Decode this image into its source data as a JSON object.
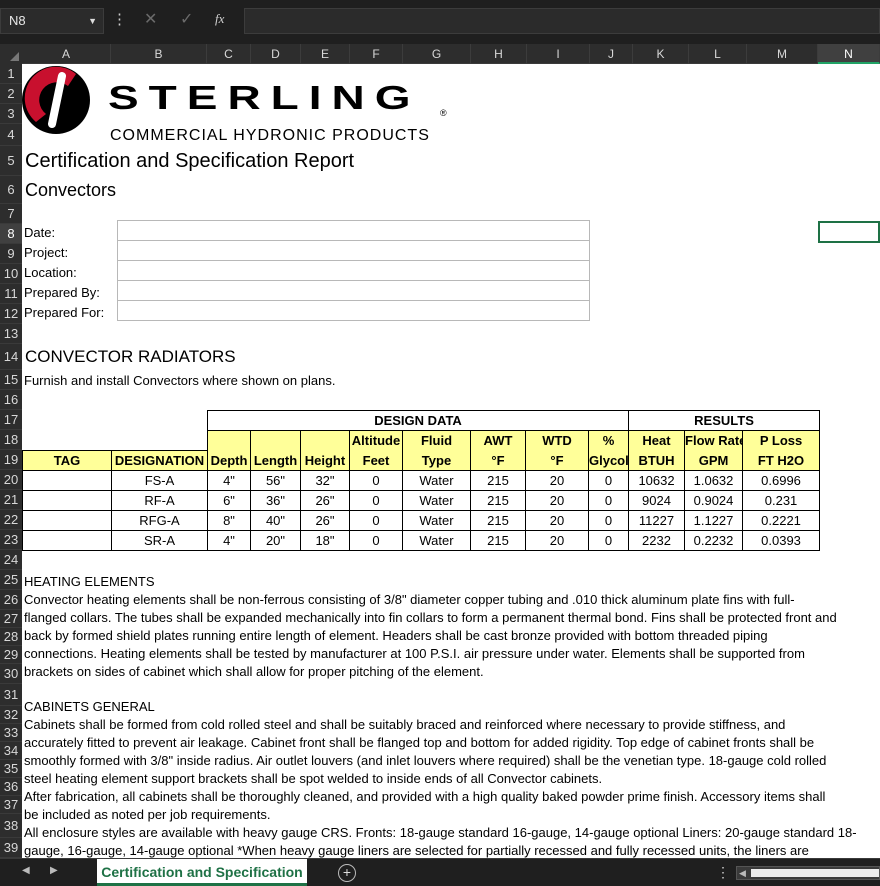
{
  "formula_bar": {
    "name_box": "N8",
    "more": "⋮",
    "cancel": "✕",
    "enter": "✓",
    "fx": "fx",
    "formula": ""
  },
  "columns": [
    "A",
    "B",
    "C",
    "D",
    "E",
    "F",
    "G",
    "H",
    "I",
    "J",
    "K",
    "L",
    "M",
    "N"
  ],
  "selected_column": "N",
  "rows": [
    "1",
    "2",
    "3",
    "4",
    "5",
    "6",
    "7",
    "8",
    "9",
    "10",
    "11",
    "12",
    "13",
    "14",
    "15",
    "16",
    "17",
    "18",
    "19",
    "20",
    "21",
    "22",
    "23",
    "24",
    "25",
    "26",
    "27",
    "28",
    "29",
    "30",
    "31",
    "32",
    "33",
    "34",
    "35",
    "36",
    "37",
    "38",
    "39"
  ],
  "selected_row": "8",
  "logo": {
    "name": "STERLING",
    "reg": "®",
    "tagline": "COMMERCIAL HYDRONIC PRODUCTS",
    "mark_color": "#c8102e"
  },
  "report": {
    "title": "Certification and Specification Report",
    "subtitle": "Convectors"
  },
  "info_fields": [
    "Date:",
    "Project:",
    "Location:",
    "Prepared By:",
    "Prepared For:"
  ],
  "section": {
    "heading": "CONVECTOR RADIATORS",
    "note": "Furnish and install Convectors where shown on plans."
  },
  "table": {
    "design_data_label": "DESIGN DATA",
    "results_label": "RESULTS",
    "headers_top": [
      "",
      "",
      "",
      "",
      "",
      "Altitude",
      "Fluid",
      "AWT",
      "WTD",
      "%",
      "Heat",
      "Flow Rate",
      "P Loss"
    ],
    "headers_bottom": [
      "TAG",
      "DESIGNATION",
      "Depth",
      "Length",
      "Height",
      "Feet",
      "Type",
      "°F",
      "°F",
      "Glycol",
      "BTUH",
      "GPM",
      "FT H2O"
    ],
    "rows": [
      [
        "",
        "FS-A",
        "4\"",
        "56\"",
        "32\"",
        "0",
        "Water",
        "215",
        "20",
        "0",
        "10632",
        "1.0632",
        "0.6996"
      ],
      [
        "",
        "RF-A",
        "6\"",
        "36\"",
        "26\"",
        "0",
        "Water",
        "215",
        "20",
        "0",
        "9024",
        "0.9024",
        "0.231"
      ],
      [
        "",
        "RFG-A",
        "8\"",
        "40\"",
        "26\"",
        "0",
        "Water",
        "215",
        "20",
        "0",
        "11227",
        "1.1227",
        "0.2221"
      ],
      [
        "",
        "SR-A",
        "4\"",
        "20\"",
        "18\"",
        "0",
        "Water",
        "215",
        "20",
        "0",
        "2232",
        "0.2232",
        "0.0393"
      ]
    ]
  },
  "heating": {
    "heading": "HEATING ELEMENTS",
    "lines": [
      "Convector heating elements shall be non-ferrous consisting of 3/8\" diameter copper tubing and .010 thick aluminum plate fins with full-",
      "flanged collars. The tubes shall be expanded mechanically into fin collars to form a permanent thermal bond. Fins shall be protected front and",
      "back by formed shield plates running entire length of element. Headers shall be cast bronze provided with bottom threaded piping",
      "connections. Heating elements shall be tested by manufacturer at 100 P.S.I. air pressure under water. Elements shall be supported from",
      "brackets on sides of cabinet which shall allow for proper pitching of the element."
    ]
  },
  "cabinets": {
    "heading": "CABINETS GENERAL",
    "lines": [
      "Cabinets shall be formed from cold rolled steel and shall be suitably braced and reinforced where necessary to provide stiffness, and",
      "accurately fitted to prevent air leakage. Cabinet front shall be flanged top and bottom for added rigidity. Top edge of cabinet fronts shall be",
      "smoothly formed with 3/8\" inside radius. Air outlet louvers (and inlet louvers where required) shall be the venetian type. 18-gauge cold rolled",
      "steel heating element support brackets shall be spot welded to inside ends of all Convector cabinets.",
      "After fabrication, all cabinets shall be thoroughly cleaned, and provided with a high quality baked powder prime finish. Accessory items shall",
      "be included as noted per job requirements.",
      "All enclosure styles are available with heavy gauge CRS. Fronts: 18-gauge standard 16-gauge, 14-gauge optional Liners: 20-gauge standard 18-",
      "gauge, 16-gauge, 14-gauge optional *When heavy gauge liners are selected for partially recessed and fully recessed units, the liners are"
    ]
  },
  "status_bar": {
    "prev": "◀",
    "next": "▶",
    "sheet_tab": "Certification and Specification",
    "add": "+",
    "more": "⋮",
    "scroll_left": "◀"
  }
}
